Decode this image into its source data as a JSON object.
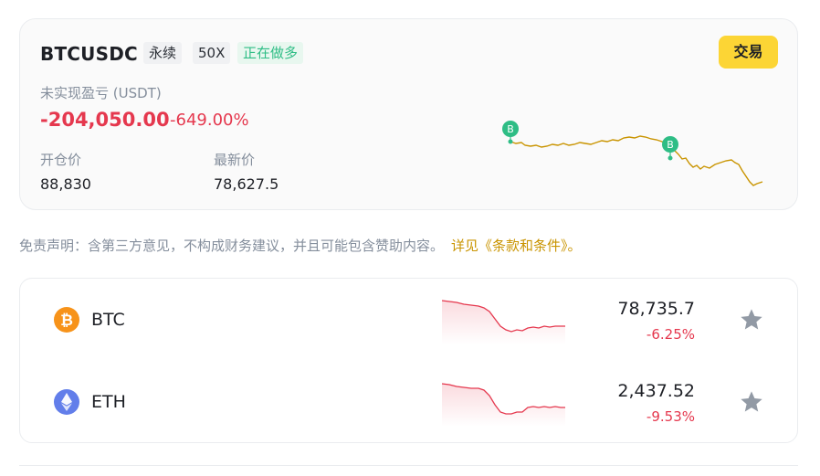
{
  "position": {
    "symbol": "BTCUSDC",
    "contract_type": "永续",
    "leverage": "50X",
    "side": "正在做多",
    "trade_button": "交易",
    "pnl_label": "未实现盈亏 (USDT)",
    "pnl_value": "-204,050.00",
    "pnl_percent": "-649.00%",
    "entry_price_label": "开仓价",
    "entry_price": "88,830",
    "last_price_label": "最新价",
    "last_price": "78,627.5",
    "buy_marker": "B"
  },
  "disclaimer": {
    "text": "免责声明：含第三方意见，不构成财务建议，并且可能包含赞助内容。",
    "link": "详见《条款和条件》。"
  },
  "markets": [
    {
      "name": "BTC",
      "price": "78,735.7",
      "change": "-6.25%",
      "icon": "bitcoin-icon",
      "icon_color": "#f7931a"
    },
    {
      "name": "ETH",
      "price": "2,437.52",
      "change": "-9.53%",
      "icon": "ethereum-icon",
      "icon_color": "#627eea"
    }
  ],
  "colors": {
    "accent_yellow": "#fcd535",
    "negative": "#e5384e",
    "positive": "#2ebd85",
    "chart_line": "#c99400",
    "link": "#c99400"
  }
}
